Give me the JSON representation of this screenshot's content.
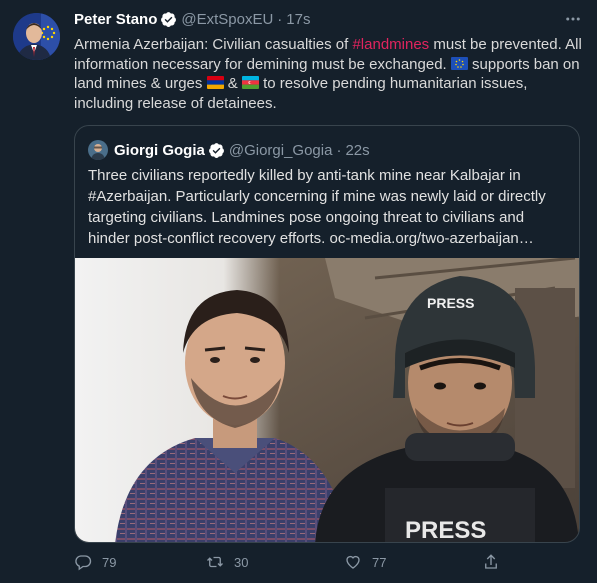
{
  "tweet": {
    "author_name": "Peter Stano",
    "author_handle": "@ExtSpoxEU",
    "separator": "·",
    "time": "17s",
    "text": {
      "part1": "Armenia Azerbaijan: Civilian casualties of ",
      "hashtag": "#landmines",
      "part2": " must be prevented. All information necessary for demining must be exchanged. ",
      "part3": " supports ban on land mines & urges ",
      "part4": " & ",
      "part5": " to resolve pending humanitarian issues, including release of detainees."
    },
    "flags": [
      "eu-flag",
      "armenia-flag",
      "azerbaijan-flag"
    ]
  },
  "quote": {
    "author_name": "Giorgi Gogia",
    "author_handle": "@Giorgi_Gogia",
    "separator": "·",
    "time": "22s",
    "text": "Three civilians reportedly killed by anti-tank mine near Kalbajar in #Azerbaijan. Particularly concerning if mine was newly laid or directly targeting civilians. Landmines pose ongoing threat to civilians and hinder post-conflict recovery efforts. oc-media.org/two-azerbaijan…",
    "media": {
      "vest_label": "PRESS",
      "helmet_label": "PRESS"
    }
  },
  "actions": {
    "reply_count": "79",
    "retweet_count": "30",
    "like_count": "77"
  },
  "colors": {
    "background": "#15202b",
    "text": "#d9d9d9",
    "secondary": "#8b98a5",
    "hashtag": "#e0245e",
    "verified": "#ffffff",
    "border": "#38444d"
  },
  "icons": [
    "verified-icon",
    "more-icon",
    "reply-icon",
    "retweet-icon",
    "like-icon",
    "share-icon"
  ]
}
